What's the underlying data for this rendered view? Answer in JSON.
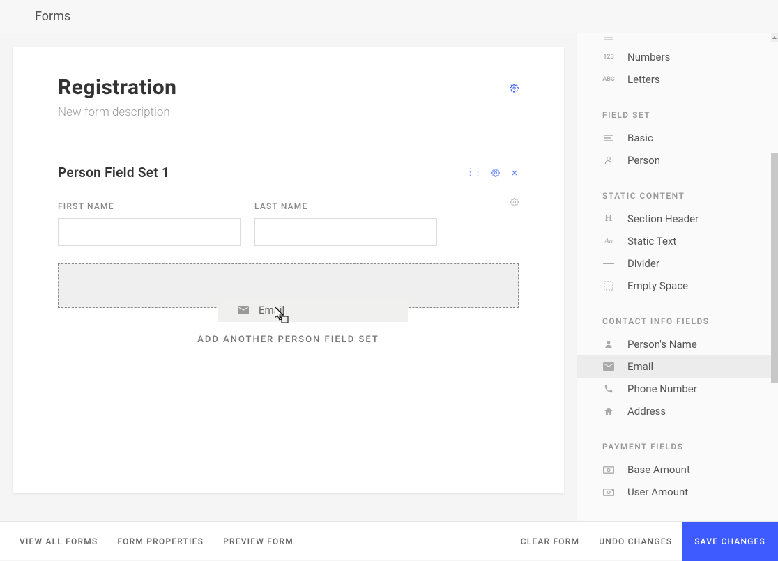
{
  "header": {
    "title": "Forms"
  },
  "form": {
    "title": "Registration",
    "description": "New form description"
  },
  "fieldset": {
    "title": "Person Field Set 1",
    "fields": {
      "first_name_label": "FIRST NAME",
      "last_name_label": "LAST NAME"
    },
    "add_another": "ADD ANOTHER PERSON FIELD SET"
  },
  "dragging": {
    "label": "Email"
  },
  "sidebar": {
    "partial_top": [
      {
        "icon": "box",
        "label": ""
      }
    ],
    "items_top": [
      {
        "icon": "123",
        "label": "Numbers"
      },
      {
        "icon": "ABC",
        "label": "Letters"
      }
    ],
    "sections": [
      {
        "header": "FIELD SET",
        "items": [
          {
            "icon": "lines",
            "label": "Basic"
          },
          {
            "icon": "person-outline",
            "label": "Person"
          }
        ]
      },
      {
        "header": "STATIC CONTENT",
        "items": [
          {
            "icon": "H",
            "label": "Section Header"
          },
          {
            "icon": "Aa",
            "label": "Static Text"
          },
          {
            "icon": "divider",
            "label": "Divider"
          },
          {
            "icon": "empty",
            "label": "Empty Space"
          }
        ]
      },
      {
        "header": "CONTACT INFO FIELDS",
        "items": [
          {
            "icon": "person-solid",
            "label": "Person's Name"
          },
          {
            "icon": "mail",
            "label": "Email",
            "highlighted": true
          },
          {
            "icon": "phone",
            "label": "Phone Number"
          },
          {
            "icon": "home",
            "label": "Address"
          }
        ]
      },
      {
        "header": "PAYMENT FIELDS",
        "items": [
          {
            "icon": "money",
            "label": "Base Amount"
          },
          {
            "icon": "money-plus",
            "label": "User Amount"
          }
        ]
      }
    ]
  },
  "footer": {
    "view_all": "VIEW ALL FORMS",
    "properties": "FORM PROPERTIES",
    "preview": "PREVIEW FORM",
    "clear": "CLEAR FORM",
    "undo": "UNDO CHANGES",
    "save": "SAVE CHANGES"
  }
}
